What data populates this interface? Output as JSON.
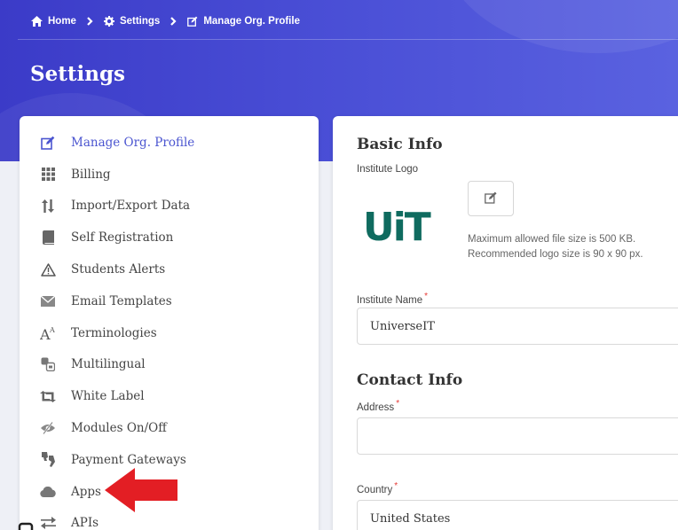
{
  "breadcrumb": {
    "home": "Home",
    "settings": "Settings",
    "current": "Manage Org. Profile"
  },
  "page": {
    "title": "Settings"
  },
  "menu": {
    "items": [
      {
        "label": "Manage Org. Profile",
        "icon": "edit-icon",
        "active": true
      },
      {
        "label": "Billing",
        "icon": "grid-icon"
      },
      {
        "label": "Import/Export Data",
        "icon": "sort-arrows-icon"
      },
      {
        "label": "Self Registration",
        "icon": "book-icon"
      },
      {
        "label": "Students Alerts",
        "icon": "warning-icon"
      },
      {
        "label": "Email Templates",
        "icon": "envelope-icon"
      },
      {
        "label": "Terminologies",
        "icon": "font-size-icon"
      },
      {
        "label": "Multilingual",
        "icon": "translate-icon"
      },
      {
        "label": "White Label",
        "icon": "retweet-icon"
      },
      {
        "label": "Modules On/Off",
        "icon": "eye-slash-icon"
      },
      {
        "label": "Payment Gateways",
        "icon": "payment-icon"
      },
      {
        "label": "Apps",
        "icon": "cloud-icon"
      },
      {
        "label": "APIs",
        "icon": "exchange-icon"
      }
    ]
  },
  "form": {
    "basic_info_title": "Basic Info",
    "logo_label": "Institute Logo",
    "logo_text": "UiT",
    "logo_note_1": "Maximum allowed file size is 500 KB.",
    "logo_note_2": "Recommended logo size is 90 x 90 px.",
    "name_label": "Institute Name",
    "name_value": "UniverseIT",
    "contact_info_title": "Contact Info",
    "address_label": "Address",
    "address_value": "",
    "country_label": "Country",
    "country_value": "United States",
    "required_mark": "*"
  },
  "colors": {
    "banner": "#4347d0",
    "accent": "#4b55d0",
    "logo": "#0f6b5f",
    "required": "#e53935",
    "annotation_arrow": "#e31e24"
  }
}
